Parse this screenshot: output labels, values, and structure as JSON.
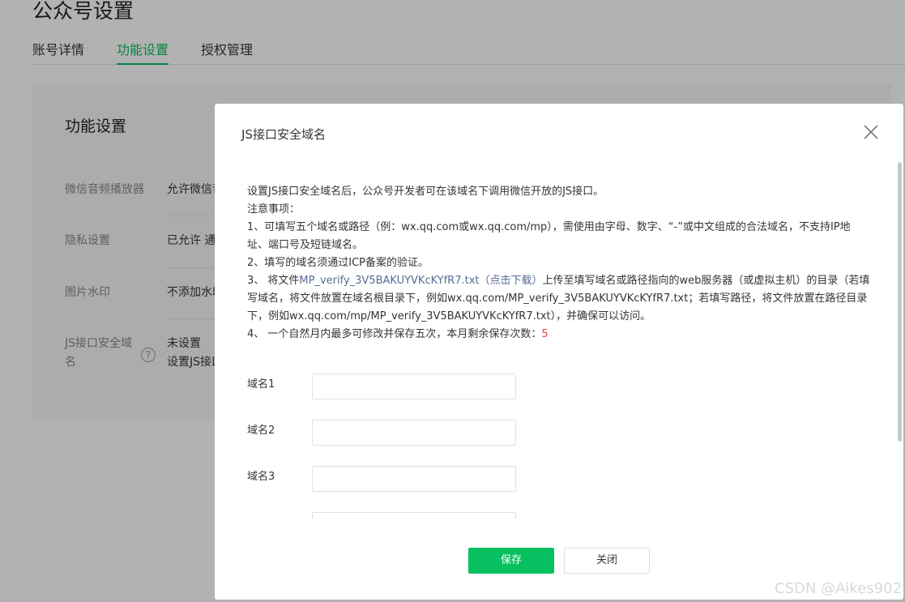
{
  "page": {
    "title": "公众号设置",
    "tabs": [
      "账号详情",
      "功能设置",
      "授权管理"
    ],
    "active_tab": "功能设置"
  },
  "card": {
    "title": "功能设置",
    "rows": [
      {
        "label": "微信音频播放器",
        "value": "允许微信音"
      },
      {
        "label": "隐私设置",
        "value": "已允许 通"
      },
      {
        "label": "图片水印",
        "value": "不添加水印"
      },
      {
        "label": "JS接口安全域名",
        "value": "未设置",
        "value2": "设置JS接口"
      }
    ],
    "help_icon": "?"
  },
  "dialog": {
    "title": "JS接口安全域名",
    "intro": "设置JS接口安全域名后，公众号开发者可在该域名下调用微信开放的JS接口。",
    "notice_heading": "注意事项：",
    "item1": "1、可填写五个域名或路径（例：wx.qq.com或wx.qq.com/mp），需使用由字母、数字、“-”或中文组成的合法域名，不支持IP地址、端口号及短链域名。",
    "item2": "2、填写的域名须通过ICP备案的验证。",
    "item3_prefix": "3、 将文件",
    "item3_link": "MP_verify_3V5BAKUYVKcKYfR7.txt（点击下载）",
    "item3_suffix": "上传至填写域名或路径指向的web服务器（或虚拟主机）的目录（若填写域名，将文件放置在域名根目录下，例如wx.qq.com/MP_verify_3V5BAKUYVKcKYfR7.txt；若填写路径，将文件放置在路径目录下，例如wx.qq.com/mp/MP_verify_3V5BAKUYVKcKYfR7.txt），并确保可以访问。",
    "item4_prefix": "4、 一个自然月内最多可修改并保存五次，本月剩余保存次数：",
    "item4_count": "5",
    "fields": [
      {
        "label": "域名1",
        "value": ""
      },
      {
        "label": "域名2",
        "value": ""
      },
      {
        "label": "域名3",
        "value": ""
      },
      {
        "label": "",
        "value": ""
      }
    ],
    "save_label": "保存",
    "close_label": "关闭"
  },
  "watermark": "CSDN @Aikes902",
  "colors": {
    "accent": "#07c160",
    "link": "#576b95",
    "count": "#e64340"
  }
}
